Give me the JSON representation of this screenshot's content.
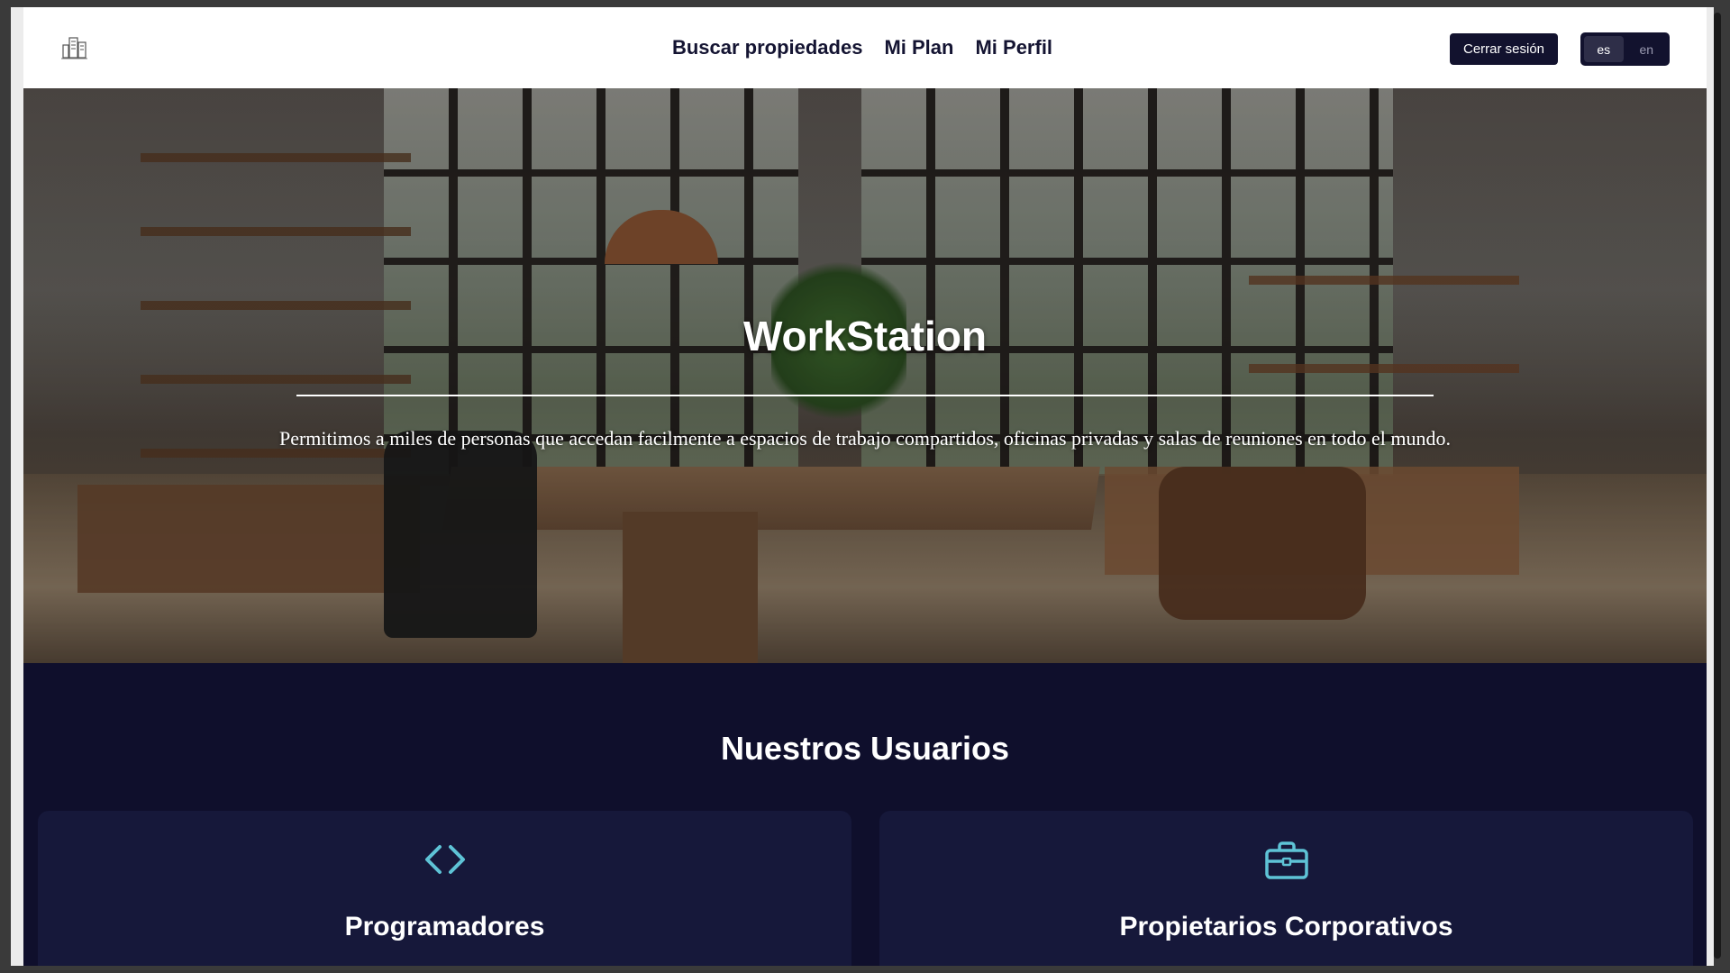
{
  "header": {
    "logo_icon": "building-logo-icon",
    "nav": [
      {
        "label": "Buscar propiedades"
      },
      {
        "label": "Mi Plan"
      },
      {
        "label": "Mi Perfil"
      }
    ],
    "logout_label": "Cerrar sesión",
    "languages": [
      {
        "label": "es",
        "active": true
      },
      {
        "label": "en",
        "active": false
      }
    ]
  },
  "hero": {
    "title": "WorkStation",
    "text": "Permitimos a miles de personas que accedan facilmente a espacios de trabajo compartidos, oficinas privadas y salas de reuniones en todo el mundo."
  },
  "users": {
    "title": "Nuestros Usuarios",
    "cards": [
      {
        "icon": "code-icon",
        "title": "Programadores"
      },
      {
        "icon": "briefcase-icon",
        "title": "Propietarios Corporativos"
      }
    ]
  },
  "colors": {
    "navy": "#12122e",
    "section_bg": "#0f0f2c",
    "card_bg": "#16183a",
    "icon_accent": "#5ec3d6"
  }
}
